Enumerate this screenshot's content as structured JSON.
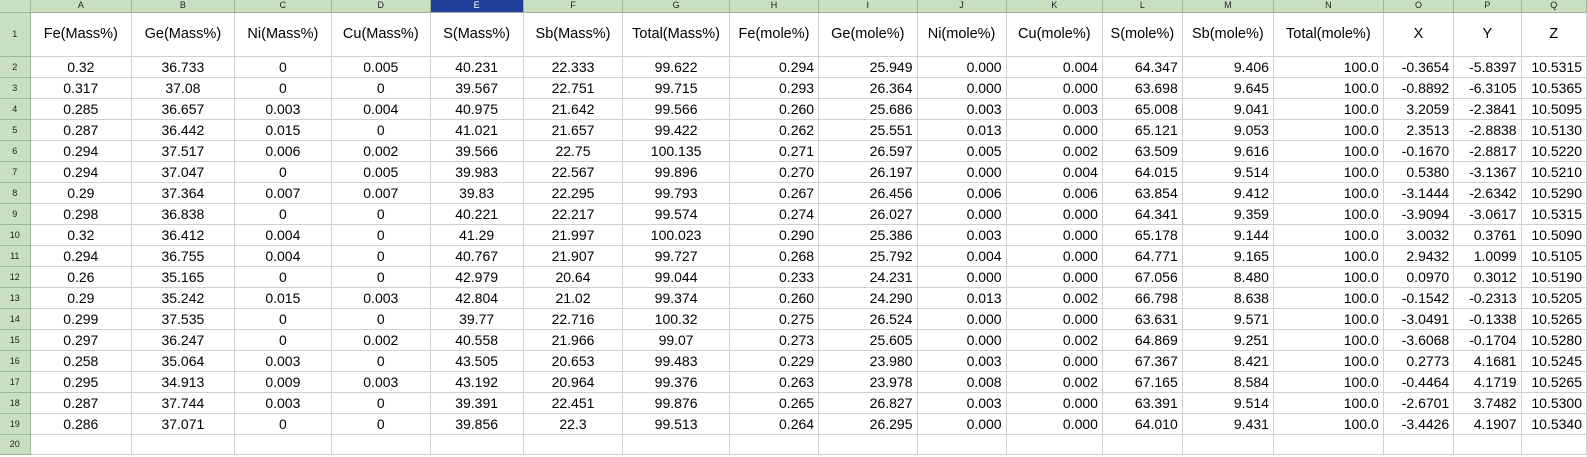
{
  "columns": [
    "A",
    "B",
    "C",
    "D",
    "E",
    "F",
    "G",
    "H",
    "I",
    "J",
    "K",
    "L",
    "M",
    "N",
    "O",
    "P",
    "Q"
  ],
  "selected_column": "E",
  "headers": [
    "Fe(Mass%)",
    "Ge(Mass%)",
    "Ni(Mass%)",
    "Cu(Mass%)",
    "S(Mass%)",
    "Sb(Mass%)",
    "Total(Mass%)",
    "Fe(mole%)",
    "Ge(mole%)",
    "Ni(mole%)",
    "Cu(mole%)",
    "S(mole%)",
    "Sb(mole%)",
    "Total(mole%)",
    "X",
    "Y",
    "Z"
  ],
  "row_numbers": [
    "1",
    "2",
    "3",
    "4",
    "5",
    "6",
    "7",
    "8",
    "9",
    "10",
    "11",
    "12",
    "13",
    "14",
    "15",
    "16",
    "17",
    "18",
    "19",
    "20"
  ],
  "rows": [
    [
      "0.32",
      "36.733",
      "0",
      "0.005",
      "40.231",
      "22.333",
      "99.622",
      "0.294",
      "25.949",
      "0.000",
      "0.004",
      "64.347",
      "9.406",
      "100.0",
      "-0.3654",
      "-5.8397",
      "10.5315"
    ],
    [
      "0.317",
      "37.08",
      "0",
      "0",
      "39.567",
      "22.751",
      "99.715",
      "0.293",
      "26.364",
      "0.000",
      "0.000",
      "63.698",
      "9.645",
      "100.0",
      "-0.8892",
      "-6.3105",
      "10.5365"
    ],
    [
      "0.285",
      "36.657",
      "0.003",
      "0.004",
      "40.975",
      "21.642",
      "99.566",
      "0.260",
      "25.686",
      "0.003",
      "0.003",
      "65.008",
      "9.041",
      "100.0",
      "3.2059",
      "-2.3841",
      "10.5095"
    ],
    [
      "0.287",
      "36.442",
      "0.015",
      "0",
      "41.021",
      "21.657",
      "99.422",
      "0.262",
      "25.551",
      "0.013",
      "0.000",
      "65.121",
      "9.053",
      "100.0",
      "2.3513",
      "-2.8838",
      "10.5130"
    ],
    [
      "0.294",
      "37.517",
      "0.006",
      "0.002",
      "39.566",
      "22.75",
      "100.135",
      "0.271",
      "26.597",
      "0.005",
      "0.002",
      "63.509",
      "9.616",
      "100.0",
      "-0.1670",
      "-2.8817",
      "10.5220"
    ],
    [
      "0.294",
      "37.047",
      "0",
      "0.005",
      "39.983",
      "22.567",
      "99.896",
      "0.270",
      "26.197",
      "0.000",
      "0.004",
      "64.015",
      "9.514",
      "100.0",
      "0.5380",
      "-3.1367",
      "10.5210"
    ],
    [
      "0.29",
      "37.364",
      "0.007",
      "0.007",
      "39.83",
      "22.295",
      "99.793",
      "0.267",
      "26.456",
      "0.006",
      "0.006",
      "63.854",
      "9.412",
      "100.0",
      "-3.1444",
      "-2.6342",
      "10.5290"
    ],
    [
      "0.298",
      "36.838",
      "0",
      "0",
      "40.221",
      "22.217",
      "99.574",
      "0.274",
      "26.027",
      "0.000",
      "0.000",
      "64.341",
      "9.359",
      "100.0",
      "-3.9094",
      "-3.0617",
      "10.5315"
    ],
    [
      "0.32",
      "36.412",
      "0.004",
      "0",
      "41.29",
      "21.997",
      "100.023",
      "0.290",
      "25.386",
      "0.003",
      "0.000",
      "65.178",
      "9.144",
      "100.0",
      "3.0032",
      "0.3761",
      "10.5090"
    ],
    [
      "0.294",
      "36.755",
      "0.004",
      "0",
      "40.767",
      "21.907",
      "99.727",
      "0.268",
      "25.792",
      "0.004",
      "0.000",
      "64.771",
      "9.165",
      "100.0",
      "2.9432",
      "1.0099",
      "10.5105"
    ],
    [
      "0.26",
      "35.165",
      "0",
      "0",
      "42.979",
      "20.64",
      "99.044",
      "0.233",
      "24.231",
      "0.000",
      "0.000",
      "67.056",
      "8.480",
      "100.0",
      "0.0970",
      "0.3012",
      "10.5190"
    ],
    [
      "0.29",
      "35.242",
      "0.015",
      "0.003",
      "42.804",
      "21.02",
      "99.374",
      "0.260",
      "24.290",
      "0.013",
      "0.002",
      "66.798",
      "8.638",
      "100.0",
      "-0.1542",
      "-0.2313",
      "10.5205"
    ],
    [
      "0.299",
      "37.535",
      "0",
      "0",
      "39.77",
      "22.716",
      "100.32",
      "0.275",
      "26.524",
      "0.000",
      "0.000",
      "63.631",
      "9.571",
      "100.0",
      "-3.0491",
      "-0.1338",
      "10.5265"
    ],
    [
      "0.297",
      "36.247",
      "0",
      "0.002",
      "40.558",
      "21.966",
      "99.07",
      "0.273",
      "25.605",
      "0.000",
      "0.002",
      "64.869",
      "9.251",
      "100.0",
      "-3.6068",
      "-0.1704",
      "10.5280"
    ],
    [
      "0.258",
      "35.064",
      "0.003",
      "0",
      "43.505",
      "20.653",
      "99.483",
      "0.229",
      "23.980",
      "0.003",
      "0.000",
      "67.367",
      "8.421",
      "100.0",
      "0.2773",
      "4.1681",
      "10.5245"
    ],
    [
      "0.295",
      "34.913",
      "0.009",
      "0.003",
      "43.192",
      "20.964",
      "99.376",
      "0.263",
      "23.978",
      "0.008",
      "0.002",
      "67.165",
      "8.584",
      "100.0",
      "-0.4464",
      "4.1719",
      "10.5265"
    ],
    [
      "0.287",
      "37.744",
      "0.003",
      "0",
      "39.391",
      "22.451",
      "99.876",
      "0.265",
      "26.827",
      "0.003",
      "0.000",
      "63.391",
      "9.514",
      "100.0",
      "-2.6701",
      "3.7482",
      "10.5300"
    ],
    [
      "0.286",
      "37.071",
      "0",
      "0",
      "39.856",
      "22.3",
      "99.513",
      "0.264",
      "26.295",
      "0.000",
      "0.000",
      "64.010",
      "9.431",
      "100.0",
      "-3.4426",
      "4.1907",
      "10.5340"
    ]
  ],
  "colors": {
    "header_bg": "#c9dfc3",
    "selected_header_bg": "#1f3f99",
    "grid_line": "#d0d0d0"
  }
}
